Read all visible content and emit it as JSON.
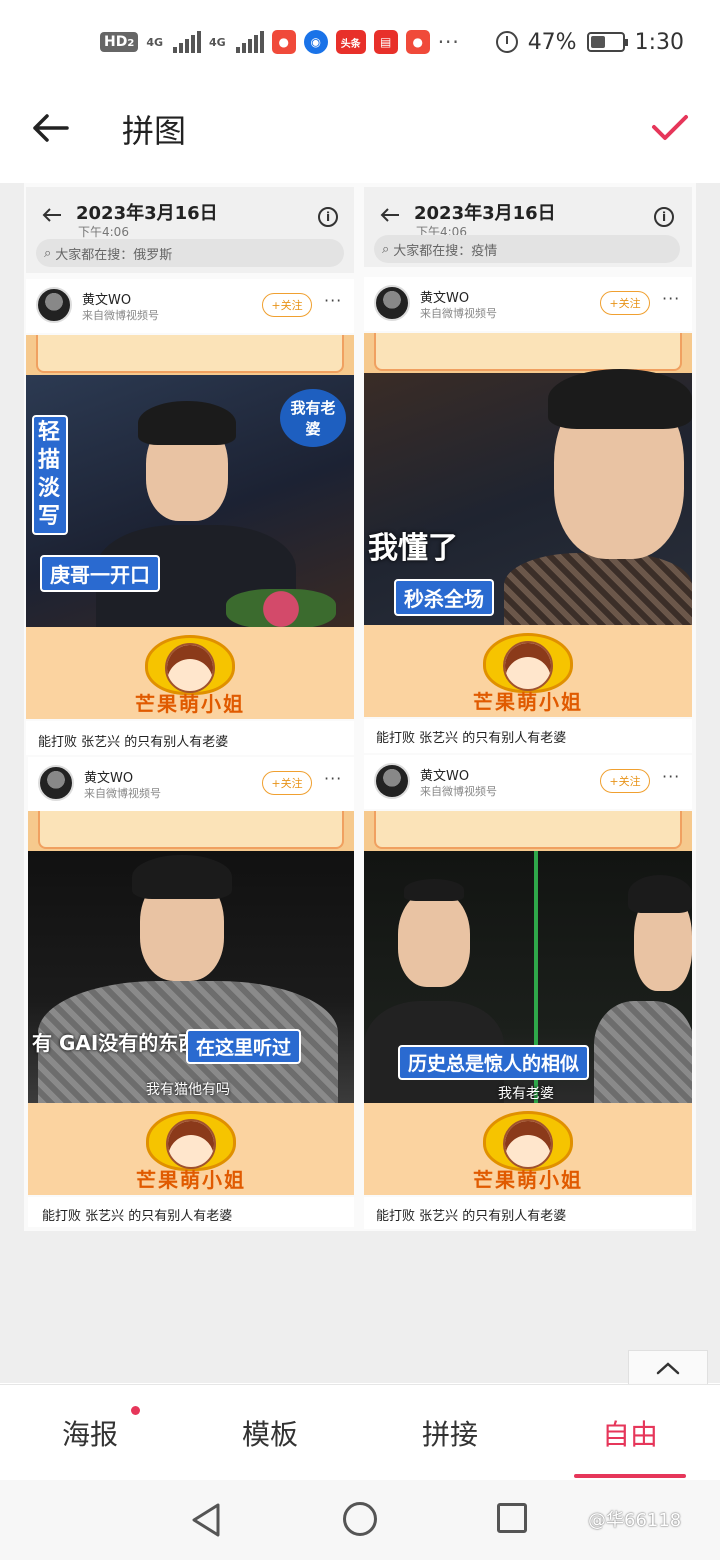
{
  "status_bar": {
    "hd_label": "HD",
    "hd_sub": "2",
    "net1": "4G",
    "net2": "4G",
    "app_toutiao": "头条",
    "battery": "47%",
    "time": "1:30",
    "battery_level": 0.47
  },
  "header": {
    "title": "拼图"
  },
  "collage": {
    "tiles": [
      {
        "date": "2023年3月16日",
        "time": "下午4:06",
        "search": "大家都在搜：俄罗斯"
      },
      {
        "date": "2023年3月16日",
        "time": "下午4:06",
        "search": "大家都在搜：疫情"
      }
    ],
    "posts": [
      {
        "user": "黄文WO",
        "source": "来自微博视频号",
        "follow": "+关注",
        "caption": "能打败 张艺兴 的只有别人有老婆",
        "subtitle_main": "庚哥一开口",
        "subtitle_side": "轻描淡写",
        "bubble": "我有老婆"
      },
      {
        "user": "黄文WO",
        "source": "来自微博视频号",
        "follow": "+关注",
        "caption": "能打败 张艺兴 的只有别人有老婆",
        "subtitle_main": "秒杀全场",
        "subtitle_top": "我懂了"
      },
      {
        "user": "黄文WO",
        "source": "来自微博视频号",
        "follow": "+关注",
        "caption": "能打败 张艺兴 的只有别人有老婆",
        "subtitle_main": "在这里听过",
        "subtitle_top": "有 GAI没有的东西",
        "subtitle_white": "我有猫他有吗"
      },
      {
        "user": "黄文WO",
        "source": "来自微博视频号",
        "follow": "+关注",
        "caption": "能打败 张艺兴 的只有别人有老婆",
        "subtitle_main": "历史总是惊人的相似",
        "subtitle_white": "我有老婆"
      }
    ],
    "logo_text": "芒果萌小姐"
  },
  "tabs": [
    {
      "label": "海报",
      "has_dot": true
    },
    {
      "label": "模板",
      "has_dot": false
    },
    {
      "label": "拼接",
      "has_dot": false
    },
    {
      "label": "自由",
      "active": true
    }
  ],
  "watermark": "@华66118",
  "colors": {
    "accent": "#e6365a",
    "follow": "#e8941a"
  }
}
